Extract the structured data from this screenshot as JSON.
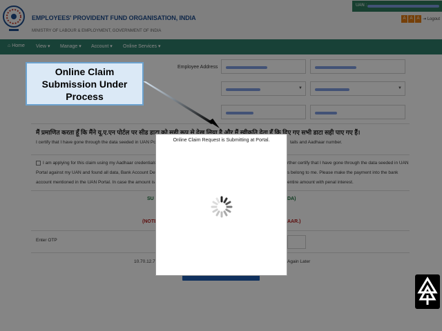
{
  "header": {
    "org_name": "EMPLOYEES' PROVIDENT FUND ORGANISATION, INDIA",
    "ministry": "MINISTRY OF LABOUR & EMPLOYMENT, GOVERNMENT OF INDIA",
    "uan_label": "UAN :",
    "font_buttons": [
      "A",
      "A",
      "A"
    ],
    "logout_label": "Logout"
  },
  "nav": {
    "home": "Home",
    "view": "View ▾",
    "manage": "Manage ▾",
    "account": "Account ▾",
    "online_services": "Online Services ▾"
  },
  "form": {
    "employee_address_label": "Employee Address",
    "hindi_declaration": "मैं प्रमाणित करता हूँ कि मैंने यू.ए.एन पोर्टल पर सीड डाटा को सही रूप से देख लिया है और मैं स्वीकृति देता हूँ कि दिए गए सभी डाटा सही पाए गए हैं।",
    "certify_left": "I certify that I have gone through the data seeded in UAN Por",
    "certify_right": "tails and Aadhaar number.",
    "consent_left": [
      "I am applying for this claim using my Aadhaar credentials. C",
      "Portal against my UAN and found all data, Bank Account Details",
      "account mentioned in the UAN Portal. In case the amount is use"
    ],
    "consent_right": [
      "rther certify that I have gone through the data seeded in UAN",
      "s belong to me. Please make the payment into the bank",
      "entire amount with penal interest."
    ],
    "submit_left": "SU",
    "submit_right": "DA)",
    "note_left": "(NOTE",
    "note_right": "AAR.)",
    "enter_otp_label": "Enter OTP",
    "ip_text": "10.70.12.73",
    "again_later": "Again Later"
  },
  "modal": {
    "message": "Online Claim Request is Submitting at Portal."
  },
  "callout": {
    "text": "Online Claim Submission Under Process"
  },
  "colors": {
    "nav_bg": "#2e7d6a",
    "org_blue": "#1d4c8c",
    "callout_bg": "#dbe9f6",
    "callout_border": "#6ba2cf",
    "overlay": "rgba(0,0,0,0.48)"
  }
}
